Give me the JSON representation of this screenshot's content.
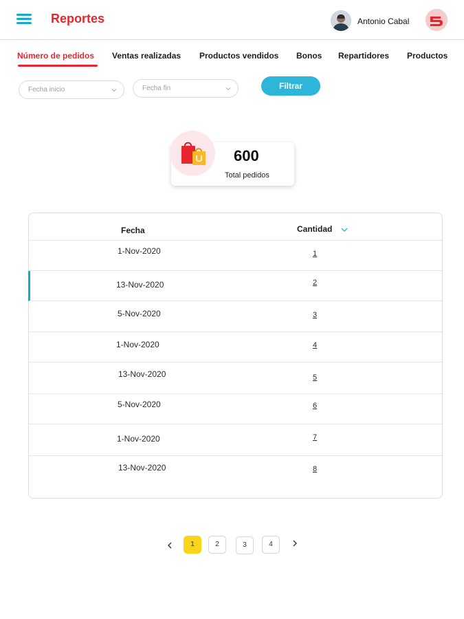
{
  "header": {
    "title": "Reportes",
    "user_name": "Antonio Cabal",
    "menu_icon": "hamburger-menu-icon",
    "brand_icon": "brand-logo-icon"
  },
  "tabs": [
    {
      "label": "Número de pedidos",
      "active": true
    },
    {
      "label": "Ventas realizadas",
      "active": false
    },
    {
      "label": "Productos vendidos",
      "active": false
    },
    {
      "label": "Bonos",
      "active": false
    },
    {
      "label": "Repartidores",
      "active": false
    },
    {
      "label": "Productos",
      "active": false
    }
  ],
  "filters": {
    "start_placeholder": "Fecha inicio",
    "end_placeholder": "Fecha fin",
    "filter_button": "Filtrar"
  },
  "summary": {
    "value": "600",
    "label": "Total pedidos",
    "icon": "shopping-bags-icon"
  },
  "table": {
    "columns": [
      "Fecha",
      "Cantidad"
    ],
    "sort_icon": "chevron-down-icon",
    "rows": [
      {
        "date": "1-Nov-2020",
        "qty": "1"
      },
      {
        "date": "13-Nov-2020",
        "qty": "2"
      },
      {
        "date": "5-Nov-2020",
        "qty": "3"
      },
      {
        "date": "1-Nov-2020",
        "qty": "4"
      },
      {
        "date": "13-Nov-2020",
        "qty": "5"
      },
      {
        "date": "5-Nov-2020",
        "qty": "6"
      },
      {
        "date": "1-Nov-2020",
        "qty": "7"
      },
      {
        "date": "13-Nov-2020",
        "qty": "8"
      }
    ],
    "selected_row": 1
  },
  "pagination": {
    "pages": [
      "1",
      "2",
      "3",
      "4"
    ],
    "current": "1"
  },
  "colors": {
    "accent_red": "#e8262d",
    "accent_blue": "#2db6d9",
    "page_active": "#f8d41c"
  }
}
